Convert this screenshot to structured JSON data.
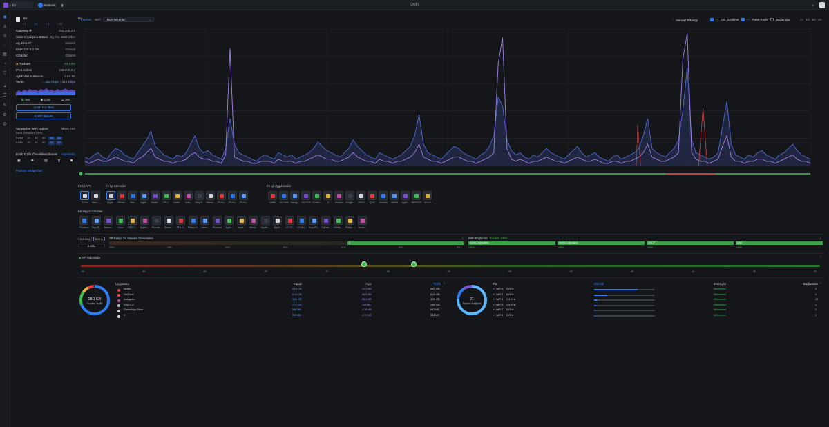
{
  "topbar": {
    "tab1": "Ev",
    "tab2": "Network",
    "title": "UniFi"
  },
  "panel": {
    "site_name": "Ev",
    "site_meta": "Hü",
    "counts": [
      "1",
      "0",
      "1",
      "22"
    ],
    "rows": [
      {
        "k": "Gateway IP",
        "v": "192.168.1.1"
      },
      {
        "k": "Sistem Çalışma Süresi",
        "v": "6g 7sa 35dk 28sn"
      },
      {
        "k": "Ağ 10.5.07",
        "v": "Güncel"
      },
      {
        "k": "UniFi OS 5.1.19",
        "v": "Güncel"
      },
      {
        "k": "Cihazlar",
        "v": "Güncel"
      }
    ],
    "isp": {
      "name": "TurkNet",
      "value": "84.44%"
    },
    "ipv4": {
      "k": "IPv4 Adresi",
      "v": "192.168.8.2"
    },
    "monthly": {
      "k": "Aylık Veri Kullanımı",
      "v": "1.63 TB"
    },
    "throughput": {
      "k": "Verim",
      "down": "↓ 282 Kbps",
      "up": "↑ 314 Kbps"
    },
    "latencies": [
      "3ms",
      "12ms",
      "3ms"
    ],
    "speedtest_label": "ISP Hız Testi",
    "wifiman_label": "WiFi Doctor",
    "wifi_title": "Varsayılan WiFi Hatları",
    "wifi_max": "Maks. Hız",
    "wifi_sub": "Kanal Genişlikleri (MHz)",
    "wifi_rows": [
      {
        "band": "5 GHz",
        "vals": [
          "20",
          "40",
          "80",
          "160",
          "320"
        ]
      },
      {
        "band": "6 GHz",
        "vals": [
          "20",
          "40",
          "80",
          "160",
          "320"
        ]
      }
    ],
    "crit_title": "Kritik Trafik Önceliklendirmesi",
    "crit_link": "Yapılandır",
    "manage_widgets": "Panoyu Widget'ları"
  },
  "filters": {
    "tab_internet": "İnternet",
    "tab_wifi": "WiFi",
    "wan_select": "Tüm WAN'lar",
    "legend": [
      "İnternet Etkinliği",
      "Ort. Gecikme",
      "Paket Kaybı",
      "Bağlantılar"
    ],
    "ranges": [
      "1s",
      "1G",
      "1H",
      "1A"
    ]
  },
  "chart_data": {
    "type": "area",
    "title": "",
    "xlabel": "",
    "ylabel": "",
    "y_axis_left_ticks": [
      "",
      "",
      "",
      "",
      ""
    ],
    "y_axis_right_ticks": [
      "",
      "",
      "",
      "",
      ""
    ],
    "series": [
      {
        "color": "#4f6bd8"
      },
      {
        "color": "#a483e8"
      },
      {
        "color": "#d84848"
      }
    ],
    "values_rel": [
      {
        "s": [
          4,
          3,
          5,
          6,
          4,
          3,
          6,
          8,
          7,
          5,
          4,
          3,
          6,
          9,
          12,
          16,
          9,
          7,
          5,
          4,
          3,
          5,
          4,
          6,
          10,
          14,
          8,
          6,
          7,
          5,
          4,
          3,
          8,
          22,
          10,
          6,
          5,
          4,
          3,
          2,
          4,
          5,
          4,
          3,
          6,
          5,
          4,
          5,
          3,
          4,
          5,
          6,
          8,
          11,
          9,
          7,
          6,
          5,
          4,
          6,
          8,
          12,
          9,
          7,
          5,
          4,
          3,
          6,
          5,
          4,
          3,
          4,
          5,
          7,
          9,
          14,
          24,
          10,
          6,
          5,
          4,
          3,
          5,
          7,
          9,
          8,
          6,
          5,
          4,
          3,
          5,
          6,
          9,
          14,
          32,
          28,
          12,
          7,
          5,
          6,
          4,
          3,
          5,
          4,
          6,
          8,
          6,
          5,
          4,
          3,
          5,
          7,
          9,
          6,
          4,
          5,
          6,
          4,
          3,
          2,
          4,
          5,
          3,
          4,
          5,
          6,
          8,
          14,
          22,
          8,
          6,
          5,
          4,
          6,
          8,
          12,
          26,
          46,
          12,
          6,
          5,
          4,
          3,
          4,
          6,
          18,
          30,
          10,
          5,
          4,
          3,
          5,
          4,
          6,
          7,
          5,
          4,
          3,
          5,
          6,
          8,
          10,
          7,
          5,
          4,
          3
        ]
      },
      {
        "s": [
          2,
          1,
          2,
          3,
          2,
          2,
          3,
          4,
          3,
          2,
          2,
          1,
          3,
          4,
          6,
          8,
          4,
          3,
          2,
          2,
          1,
          2,
          2,
          3,
          5,
          6,
          4,
          3,
          3,
          2,
          2,
          1,
          5,
          55,
          4,
          3,
          2,
          2,
          1,
          1,
          2,
          2,
          2,
          1,
          3,
          2,
          2,
          2,
          1,
          2,
          2,
          3,
          4,
          5,
          4,
          3,
          3,
          2,
          2,
          3,
          4,
          6,
          4,
          3,
          2,
          2,
          1,
          3,
          2,
          2,
          1,
          2,
          2,
          3,
          4,
          6,
          10,
          4,
          3,
          2,
          2,
          1,
          2,
          3,
          4,
          4,
          3,
          2,
          2,
          1,
          2,
          3,
          4,
          6,
          48,
          60,
          8,
          3,
          2,
          3,
          2,
          1,
          2,
          2,
          3,
          4,
          3,
          2,
          2,
          1,
          2,
          3,
          4,
          3,
          2,
          2,
          3,
          2,
          1,
          1,
          2,
          2,
          1,
          2,
          2,
          3,
          4,
          6,
          10,
          4,
          3,
          2,
          2,
          3,
          4,
          6,
          50,
          62,
          6,
          3,
          2,
          2,
          1,
          2,
          3,
          9,
          14,
          4,
          2,
          2,
          1,
          2,
          2,
          3,
          3,
          2,
          2,
          1,
          2,
          3,
          4,
          5,
          3,
          2,
          2,
          1
        ]
      }
    ],
    "x_tick_labels": [
      "",
      "",
      "",
      "",
      "",
      "",
      ""
    ]
  },
  "top_apps": {
    "ap_title": "En İyi APs",
    "ap_items": [
      "U7 Pro",
      "Nano-..."
    ],
    "client_title": "En İyi İstemciler",
    "client_items": [
      "Apple-...",
      "iPhone...",
      "Mac...",
      "Apple...",
      "Watch...",
      "TP-Li...",
      "ionele...",
      "Aras...",
      "Sony P...",
      "Samsu...",
      "TP-Lin...",
      "TP-Lin...",
      "TP-Lin..."
    ],
    "app_title": "En İyi Uygulamalar",
    "app_items": [
      "Netflix",
      "YouTube",
      "Instagr...",
      "SSL/TLS",
      "iTunes/...",
      "X",
      "Amazon",
      "Google...",
      "TikTok",
      "QUIC",
      "LinkedIn",
      "GitHub",
      "Apple...",
      "DNS/DOT",
      "iCloud"
    ]
  },
  "all_clients": {
    "title": "En Yaygın Cihazlar",
    "items": [
      "Proxmox",
      "Tapo R...",
      "Samsu...",
      "Linux",
      "HDD C...",
      "Apple I...",
      "Proxmo...",
      "Samsu...",
      "TP-Lin...",
      "Philips H...",
      "Home...",
      "Proxmox",
      "Apple...",
      "Apple...",
      "Windo...",
      "Apple I...",
      "Mgmt...",
      "LG TV...",
      "LG Wo...",
      "Sony PS...",
      "CalDav...",
      "Infinity...",
      "Philips ...",
      "Home..."
    ]
  },
  "wifi_radio": {
    "bands": [
      "2.4 GHz",
      "5 GHz",
      "6 GHz"
    ],
    "title": "AP Radyo TX Yeniden Denemeleri",
    "bar_label": "3",
    "pcts": [
      "35%↑",
      "25%",
      "20%",
      "15%",
      "10%",
      "5%",
      "0%"
    ],
    "conn_title": "WiFi Bağlantısı",
    "conn_rate": "Başarılı 100%",
    "conn_steps": [
      {
        "label": "Kimlik Doğrulama",
        "pct": "100%"
      },
      {
        "label": "Kimlik Doğrulama",
        "pct": "100%"
      },
      {
        "label": "DHCP",
        "pct": "100%"
      },
      {
        "label": "DNS",
        "pct": "100%"
      }
    ]
  },
  "signal": {
    "title": "AP Yoğunluğu",
    "ticks": [
      "-90",
      "-85",
      "-80",
      "-75",
      "-70",
      "-65",
      "-60",
      "-55",
      "-50",
      "-45",
      "-40",
      "-35",
      "-30"
    ]
  },
  "traffic": {
    "ring_value": "28.1 GB",
    "ring_label": "Toplam Trafik",
    "headers": [
      "Uygulama",
      "Kapalı",
      "Açık",
      "Trafik"
    ],
    "rows": [
      {
        "name": "Netflix",
        "down": "8.61 GB",
        "up": "21.3 MB",
        "total": "8.63 GB",
        "color": "#e23b3b"
      },
      {
        "name": "YouTube",
        "down": "8.34 GB",
        "up": "86.8 MB",
        "total": "8.43 GB",
        "color": "#ff5145"
      },
      {
        "name": "Instagram",
        "down": "4.81 GB",
        "up": "85.4 MB",
        "total": "4.90 GB",
        "color": "#c64ea6"
      },
      {
        "name": "SSL/TLS",
        "down": "2.71 GB",
        "up": "136 MB",
        "total": "2.85 GB",
        "color": "#b8bcc4"
      },
      {
        "name": "iTunes/App Store",
        "down": "586 MB",
        "up": "4.38 MB",
        "total": "663 MB",
        "color": "#d0d4da"
      },
      {
        "name": "X",
        "down": "532 MB",
        "up": "4.23 MB",
        "total": "536 MB",
        "color": "#e0e3e8"
      }
    ]
  },
  "clients_tbl": {
    "ring_value": "21",
    "ring_label": "Toplam Bağlantı",
    "headers": [
      "Tür",
      "Etkinlik",
      "Deneyim",
      "Bağlantılar"
    ],
    "rows": [
      {
        "type": "WiFi 6",
        "band": "5 GHz",
        "exp": "Mükemmel",
        "count": "3",
        "act": 0.72
      },
      {
        "type": "WiFi 7",
        "band": "6 GHz",
        "exp": "Mükemmel",
        "count": "1",
        "act": 0.22
      },
      {
        "type": "WiFi 4",
        "band": "2.4 GHz",
        "exp": "Mükemmel",
        "count": "12",
        "act": 0.06
      },
      {
        "type": "WiFi 5",
        "band": "2.4 GHz",
        "exp": "Mükemmel",
        "count": "1",
        "act": 0.03
      },
      {
        "type": "WiFi 7",
        "band": "5 GHz",
        "exp": "Mükemmel",
        "count": "1",
        "act": 0.01
      },
      {
        "type": "WiFi 4",
        "band": "5 GHz",
        "exp": "Mükemmel",
        "count": "1",
        "act": 0.01
      }
    ]
  }
}
